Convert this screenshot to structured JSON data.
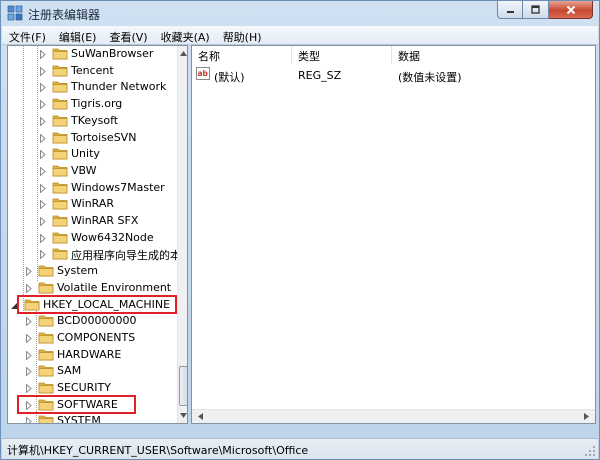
{
  "window": {
    "title": "注册表编辑器"
  },
  "menu": [
    "文件(F)",
    "编辑(E)",
    "查看(V)",
    "收藏夹(A)",
    "帮助(H)"
  ],
  "tree": {
    "software_children": [
      "SuWanBrowser",
      "Tencent",
      "Thunder Network",
      "Tigris.org",
      "TKeysoft",
      "TortoiseSVN",
      "Unity",
      "VBW",
      "Windows7Master",
      "WinRAR",
      "WinRAR SFX",
      "Wow6432Node",
      "应用程序向导生成的本"
    ],
    "user_siblings": [
      "System",
      "Volatile Environment"
    ],
    "hklm": "HKEY_LOCAL_MACHINE",
    "hklm_children": [
      "BCD00000000",
      "COMPONENTS",
      "HARDWARE",
      "SAM",
      "SECURITY",
      "SOFTWARE",
      "SYSTEM"
    ]
  },
  "list": {
    "columns": [
      "名称",
      "类型",
      "数据"
    ],
    "rows": [
      {
        "name": "(默认)",
        "type": "REG_SZ",
        "data": "(数值未设置)",
        "icon": "string-value-icon"
      }
    ]
  },
  "status": {
    "path": "计算机\\HKEY_CURRENT_USER\\Software\\Microsoft\\Office"
  },
  "colors": {
    "highlight": "#e02027",
    "folder": "#e9c25a"
  }
}
